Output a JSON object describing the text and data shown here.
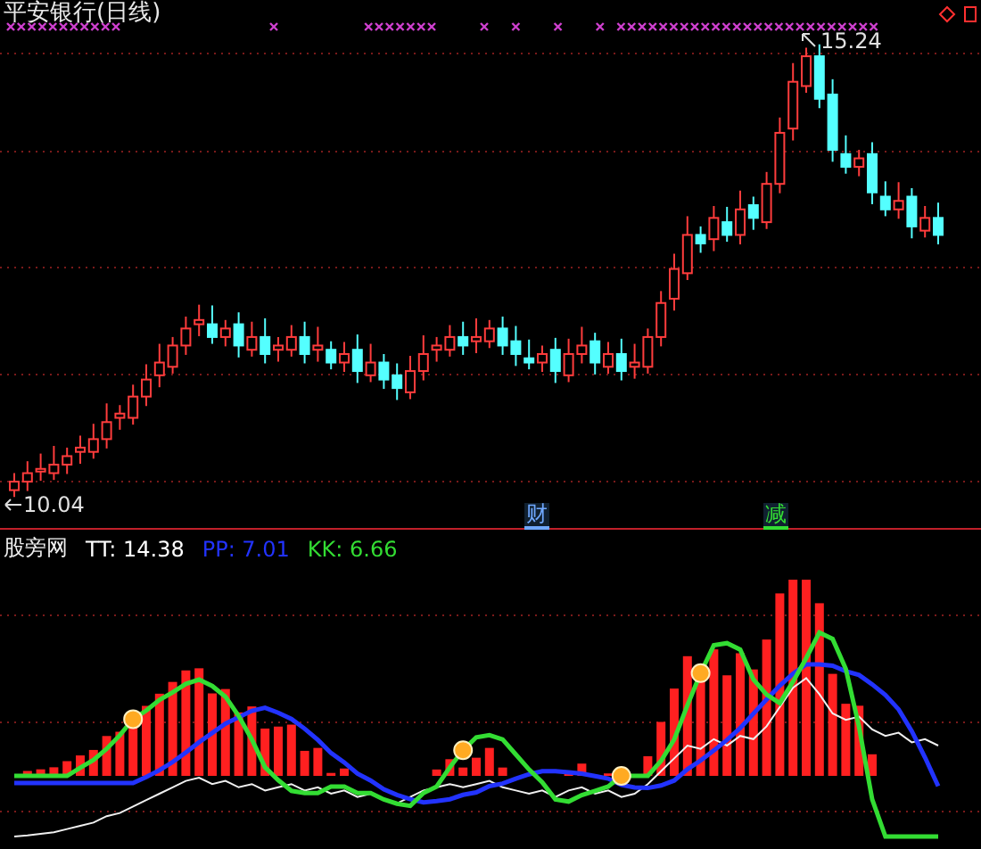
{
  "chart_title": "平安银行(日线)",
  "price_labels": [
    {
      "kind": "high",
      "text": "15.24"
    },
    {
      "kind": "low",
      "text": "10.04"
    }
  ],
  "event_tags": [
    {
      "text": "财",
      "color": "#6fa8ff"
    },
    {
      "text": "减",
      "color": "#33dd33"
    }
  ],
  "indicator": {
    "name": "股旁网",
    "values": [
      {
        "text": "TT: 14.38",
        "color": "#ffffff"
      },
      {
        "text": "PP: 7.01",
        "color": "#2233ff"
      },
      {
        "text": "KK: 6.66",
        "color": "#33dd33"
      }
    ]
  }
}
